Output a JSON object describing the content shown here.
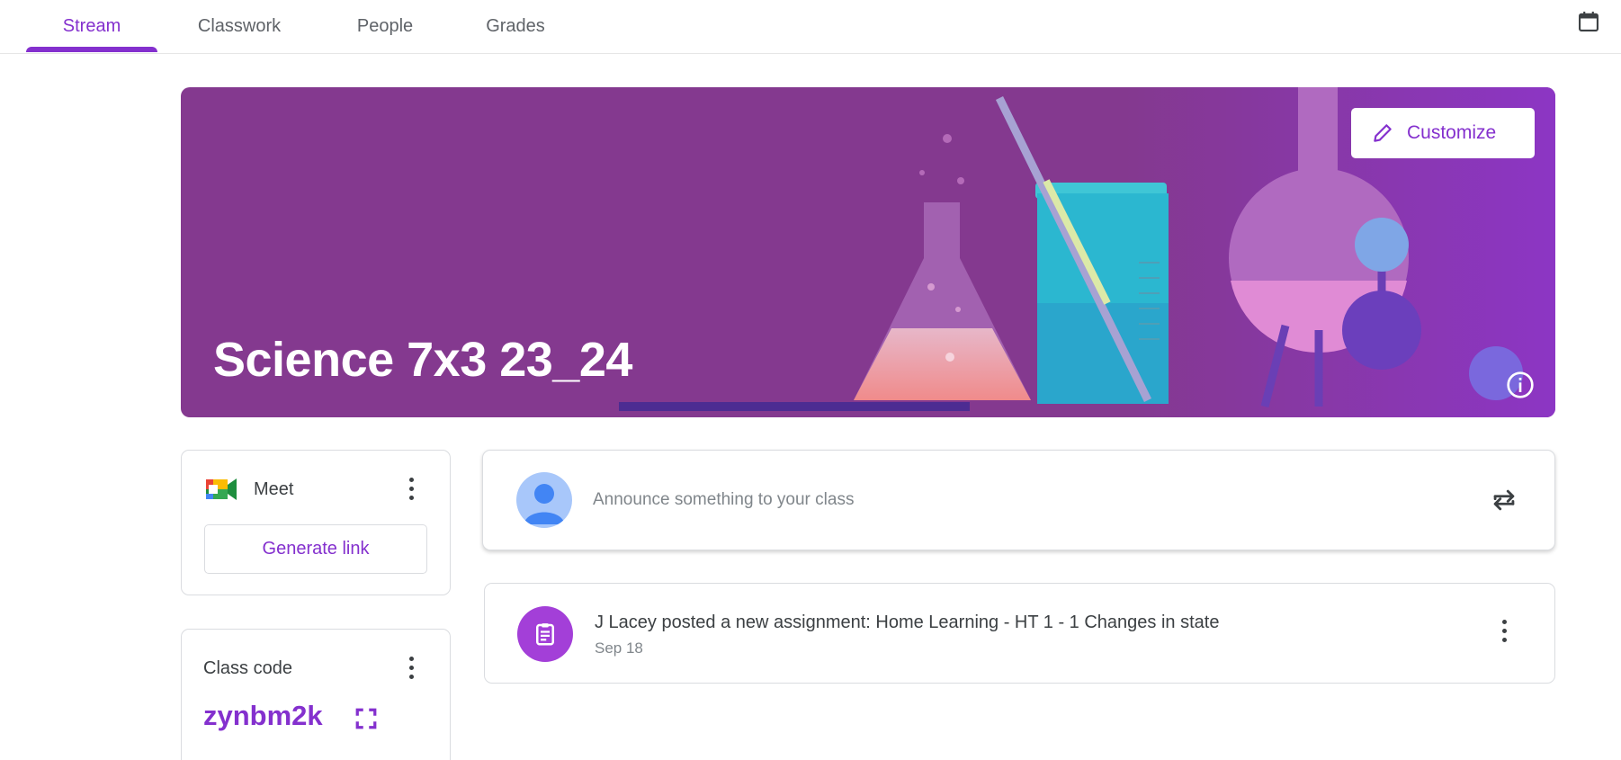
{
  "nav": {
    "tabs": [
      {
        "label": "Stream",
        "active": true
      },
      {
        "label": "Classwork",
        "active": false
      },
      {
        "label": "People",
        "active": false
      },
      {
        "label": "Grades",
        "active": false
      }
    ],
    "right_icon": "calendar-icon"
  },
  "banner": {
    "title": "Science 7x3 23_24",
    "customize_label": "Customize",
    "customize_icon": "pencil-icon",
    "info_icon": "info-icon",
    "theme_color": "#84398f"
  },
  "meet": {
    "label": "Meet",
    "generate_link_label": "Generate link"
  },
  "class_code": {
    "label": "Class code",
    "code": "zynbm2k"
  },
  "announce": {
    "placeholder": "Announce something to your class"
  },
  "posts": [
    {
      "title": "J Lacey posted a new assignment: Home Learning - HT 1 - 1 Changes in state",
      "date": "Sep 18",
      "icon": "assignment-icon"
    }
  ],
  "colors": {
    "accent": "#8430ce",
    "assignment_icon_bg": "#a33fd8"
  }
}
